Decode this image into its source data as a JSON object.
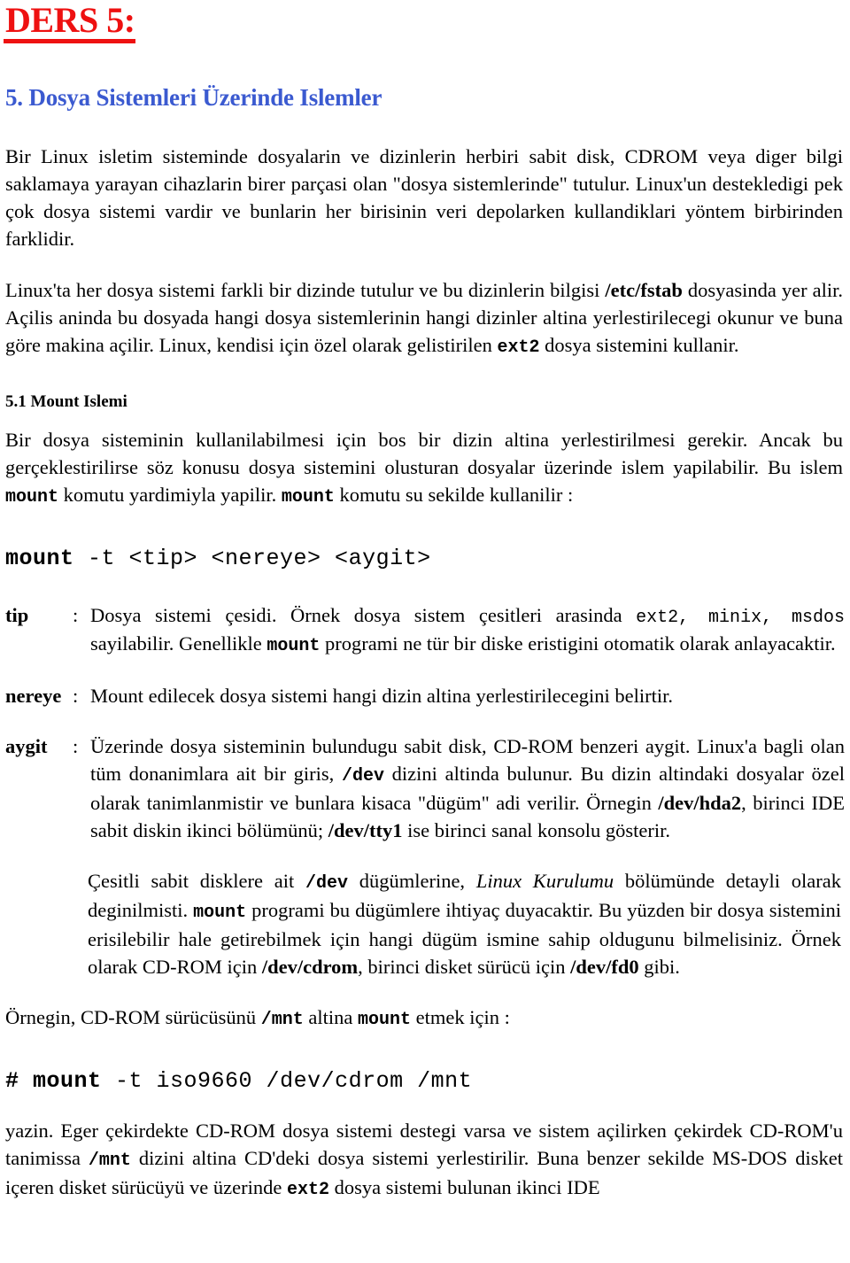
{
  "document": {
    "title": "DERS 5:",
    "title_color": "#ee1111",
    "heading_color": "#3b5ad0",
    "section_heading": "5. Dosya Sistemleri Üzerinde Islemler",
    "sub_heading": "5.1 Mount Islemi"
  },
  "paragraphs": {
    "intro_p1_a": "Bir Linux isletim sisteminde dosyalarin ve dizinlerin herbiri sabit disk, CDROM veya diger bilgi saklamaya yarayan cihazlarin birer parçasi olan \"dosya sistemlerinde\" tutulur. Linux'un destekledigi pek çok dosya sistemi vardir ve bunlarin her birisinin veri depolarken kullandiklari yöntem birbirinden farklidir.",
    "intro_p2_a": "Linux'ta her dosya sistemi farkli bir dizinde tutulur ve bu dizinlerin bilgisi ",
    "intro_p2_code1": "/etc/fstab",
    "intro_p2_b": " dosyasinda yer alir. Açilis aninda bu dosyada hangi dosya sistemlerinin hangi dizinler altina yerlestirilecegi okunur ve buna göre makina açilir. Linux, kendisi için özel olarak gelistirilen ",
    "intro_p2_code2": "ext2",
    "intro_p2_c": " dosya sistemini kullanir.",
    "mount_p_a": "Bir dosya sisteminin kullanilabilmesi için bos bir dizin altina yerlestirilmesi gerekir. Ancak bu gerçeklestirilirse söz konusu dosya sistemini olusturan dosyalar üzerinde islem yapilabilir. Bu islem ",
    "mount_p_code1": "mount",
    "mount_p_b": " komutu yardimiyla yapilir. ",
    "mount_p_code2": "mount",
    "mount_p_c": " komutu su sekilde kullanilir :"
  },
  "syntax": {
    "command": "mount",
    "args": " -t <tip> <nereye> <aygit>"
  },
  "definitions": [
    {
      "term": "tip",
      "colon": ":",
      "text_a": "Dosya sistemi çesidi. Örnek dosya sistem çesitleri arasinda ",
      "code1": "ext2, minix, msdos",
      "text_b": " sayilabilir. Genellikle ",
      "code2": "mount",
      "text_c": " programi ne tür bir diske eristigini otomatik olarak anlayacaktir."
    },
    {
      "term": "nereye",
      "colon": ":",
      "text_a": "Mount edilecek dosya sistemi hangi dizin altina yerlestirilecegini belirtir."
    },
    {
      "term": "aygit",
      "colon": ":",
      "text_a": "Üzerinde dosya sisteminin bulundugu sabit disk, CD-ROM benzeri aygit. Linux'a bagli olan tüm donanimlara ait bir giris, ",
      "code1": "/dev",
      "text_b": " dizini altinda bulunur.  Bu dizin altindaki dosyalar özel olarak tanimlanmistir ve bunlara kisaca \"dügüm\" adi verilir. Örnegin ",
      "bold1": "/dev/hda2",
      "text_c": ", birinci IDE sabit diskin ikinci bölümünü; ",
      "bold2": "/dev/tty1",
      "text_d": " ise birinci sanal konsolu gösterir."
    }
  ],
  "dev_paragraph": {
    "a": "Çesitli sabit disklere ait ",
    "code1": "/dev",
    "b": " dügümlerine, ",
    "italic1": "Linux Kurulumu",
    "c": " bölümünde detayli olarak deginilmisti. ",
    "code2": "mount",
    "d": " programi bu dügümlere ihtiyaç duyacaktir. Bu yüzden bir dosya sistemini erisilebilir hale getirebilmek için hangi dügüm ismine sahip oldugunu bilmelisiniz. Örnek olarak CD-ROM için ",
    "bold1": "/dev/cdrom",
    "e": ", birinci disket sürücü için ",
    "bold2": "/dev/fd0",
    "f": " gibi."
  },
  "example": {
    "intro_a": "Örnegin, CD-ROM sürücüsünü ",
    "intro_code1": "/mnt",
    "intro_b": " altina ",
    "intro_code2": "mount",
    "intro_c": " etmek için :",
    "command_prompt": "# ",
    "command_name": "mount",
    "command_args": " -t iso9660 /dev/cdrom /mnt"
  },
  "closing": {
    "a": "yazin. Eger çekirdekte CD-ROM dosya sistemi destegi varsa ve sistem açilirken çekirdek CD-ROM'u tanimissa ",
    "code1": "/mnt",
    "b": " dizini altina CD'deki dosya sistemi yerlestirilir. Buna benzer sekilde MS-DOS disket içeren disket sürücüyü ve üzerinde ",
    "code2": "ext2",
    "c": " dosya sistemi bulunan ikinci IDE"
  }
}
